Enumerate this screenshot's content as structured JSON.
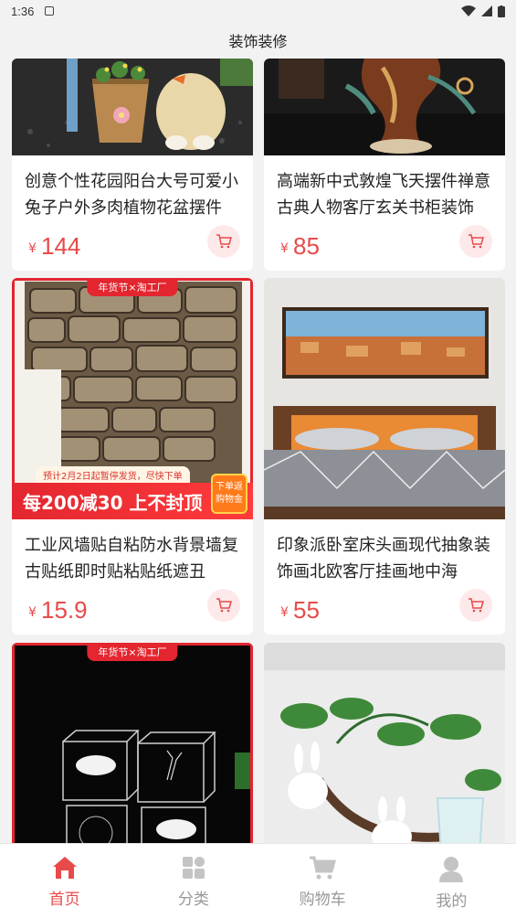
{
  "status_bar": {
    "time": "1:36"
  },
  "header": {
    "title": "装饰装修"
  },
  "products": [
    {
      "title": "创意个性花园阳台大号可爱小兔子户外多肉植物花盆摆件",
      "currency": "¥",
      "price": "144"
    },
    {
      "title": "高端新中式敦煌飞天摆件禅意古典人物客厅玄关书柜装饰",
      "currency": "¥",
      "price": "85"
    },
    {
      "title": "工业风墙贴自粘防水背景墙复古贴纸即时贴粘贴纸遮丑",
      "currency": "¥",
      "price": "15.9",
      "top_tag": "年货节×淘工厂",
      "promo_note": "预计2月2日起暂停发货，尽快下单",
      "promo_banner": "每200减30 上不封顶",
      "promo_badge": "下单返购物金"
    },
    {
      "title": "印象派卧室床头画现代抽象装饰画北欧客厅挂画地中海",
      "currency": "¥",
      "price": "55"
    },
    {
      "top_tag": "年货节×淘工厂"
    },
    {}
  ],
  "tab_bar": {
    "tabs": [
      {
        "label": "首页",
        "icon": "home-icon",
        "active": true
      },
      {
        "label": "分类",
        "icon": "category-icon",
        "active": false
      },
      {
        "label": "购物车",
        "icon": "cart-icon",
        "active": false
      },
      {
        "label": "我的",
        "icon": "profile-icon",
        "active": false
      }
    ]
  },
  "colors": {
    "accent": "#e84a4a",
    "promo_red": "#e3262f",
    "background": "#f2f2f2"
  }
}
